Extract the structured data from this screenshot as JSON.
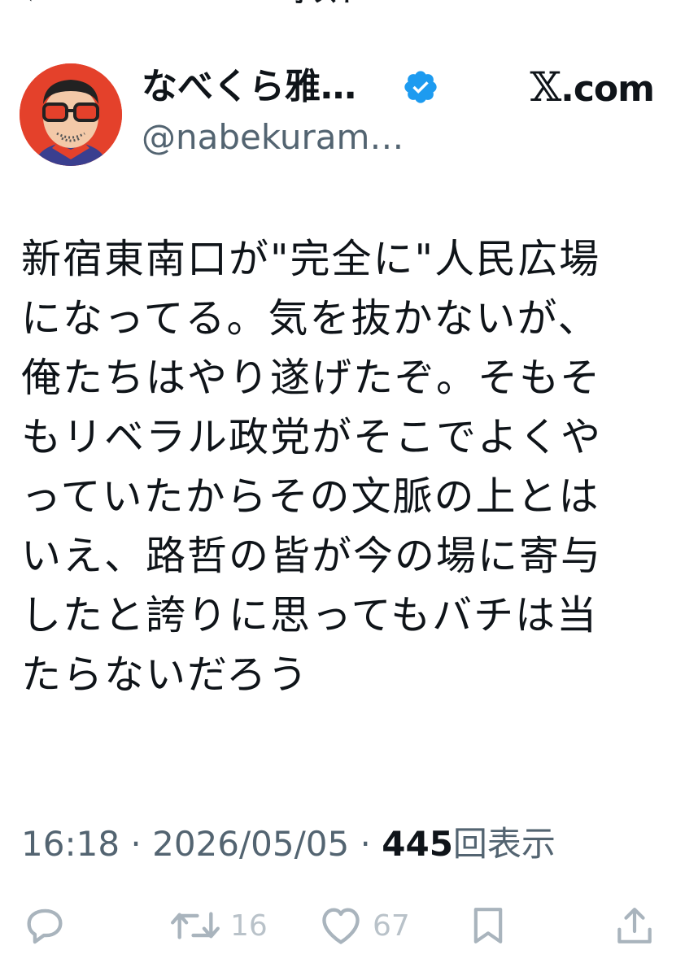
{
  "header": {
    "back_icon": "chevron-left-icon",
    "title": "ポスト"
  },
  "author": {
    "display_name": "なべくら雅…",
    "handle": "@nabekuram…",
    "verified": true,
    "verified_icon": "verified-badge-icon",
    "avatar_icon": "avatar-illustration",
    "source": ".com",
    "source_logo": "𝕏"
  },
  "tweet": {
    "text": "新宿東南口が\"完全に\"人民広場\nになってる。気を抜かないが、\n俺たちはやり遂げたぞ。そもそ\nもリベラル政党がそこでよくや\nっていたからその文脈の上とは\nいえ、路哲の皆が今の場に寄与\nしたと誇りに思ってもバチは当\nたらないだろう"
  },
  "meta": {
    "time": "16:18",
    "separator": " · ",
    "date": "2026/05/05",
    "views_count": "445",
    "views_label": "回表示"
  },
  "actions": {
    "reply_icon": "reply-icon",
    "retweet_icon": "retweet-icon",
    "retweet_count": "16",
    "like_icon": "heart-icon",
    "like_count": "67",
    "bookmark_icon": "bookmark-icon",
    "share_icon": "share-icon"
  },
  "colors": {
    "text": "#0f1419",
    "secondary": "#536471",
    "verified": "#1d9bf0",
    "action_icon": "#a9b4bd",
    "avatar_bg": "#e4412b"
  }
}
